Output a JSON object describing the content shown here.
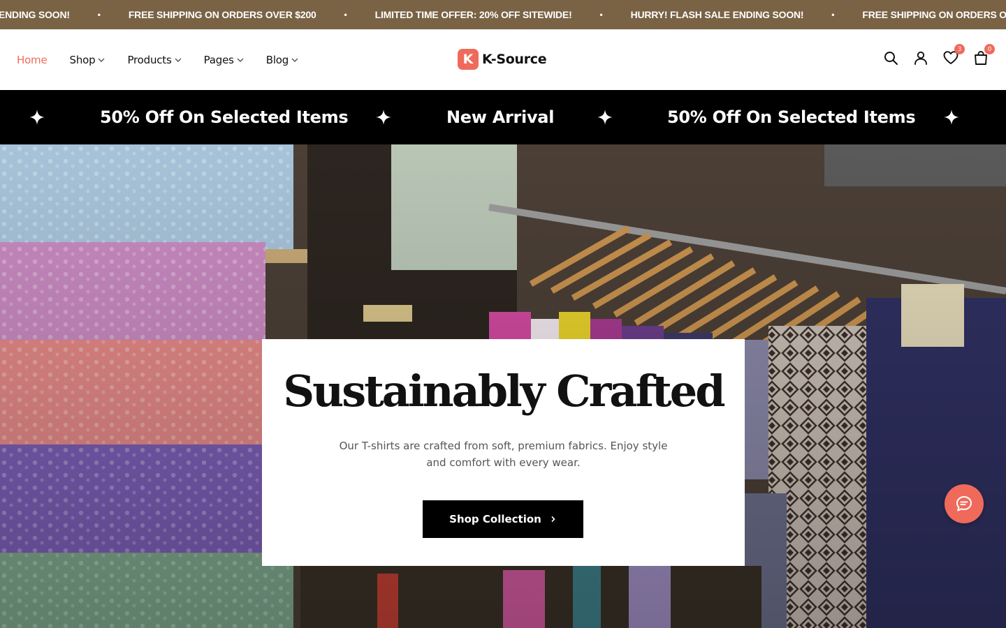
{
  "announcement": {
    "messages": [
      "ENDING SOON!",
      "FREE SHIPPING ON ORDERS OVER $200",
      "LIMITED TIME OFFER: 20% OFF SITEWIDE!",
      "HURRY! FLASH SALE ENDING SOON!",
      "FREE SHIPPING ON ORDERS OVER $"
    ],
    "separator": "•"
  },
  "nav": {
    "items": [
      {
        "label": "Home",
        "active": true,
        "dropdown": false
      },
      {
        "label": "Shop",
        "active": false,
        "dropdown": true
      },
      {
        "label": "Products",
        "active": false,
        "dropdown": true
      },
      {
        "label": "Pages",
        "active": false,
        "dropdown": true
      },
      {
        "label": "Blog",
        "active": false,
        "dropdown": true
      }
    ]
  },
  "logo": {
    "badge": "K",
    "text": "K-Source"
  },
  "header_icons": {
    "search": "search-icon",
    "account": "user-icon",
    "wishlist": {
      "icon": "heart-icon",
      "count": "3"
    },
    "cart": {
      "icon": "bag-icon",
      "count": "0"
    }
  },
  "promo": {
    "items": [
      "50% Off On Selected Items",
      "New Arrival",
      "50% Off On Selected Items"
    ]
  },
  "hero": {
    "title": "Sustainably Crafted",
    "subtitle": "Our T-shirts are crafted from soft, premium fabrics. Enjoy style and comfort with every wear.",
    "button": "Shop Collection"
  },
  "colors": {
    "accent": "#ef6a5b",
    "topbar": "#7a6245",
    "promo_bg": "#000000"
  }
}
